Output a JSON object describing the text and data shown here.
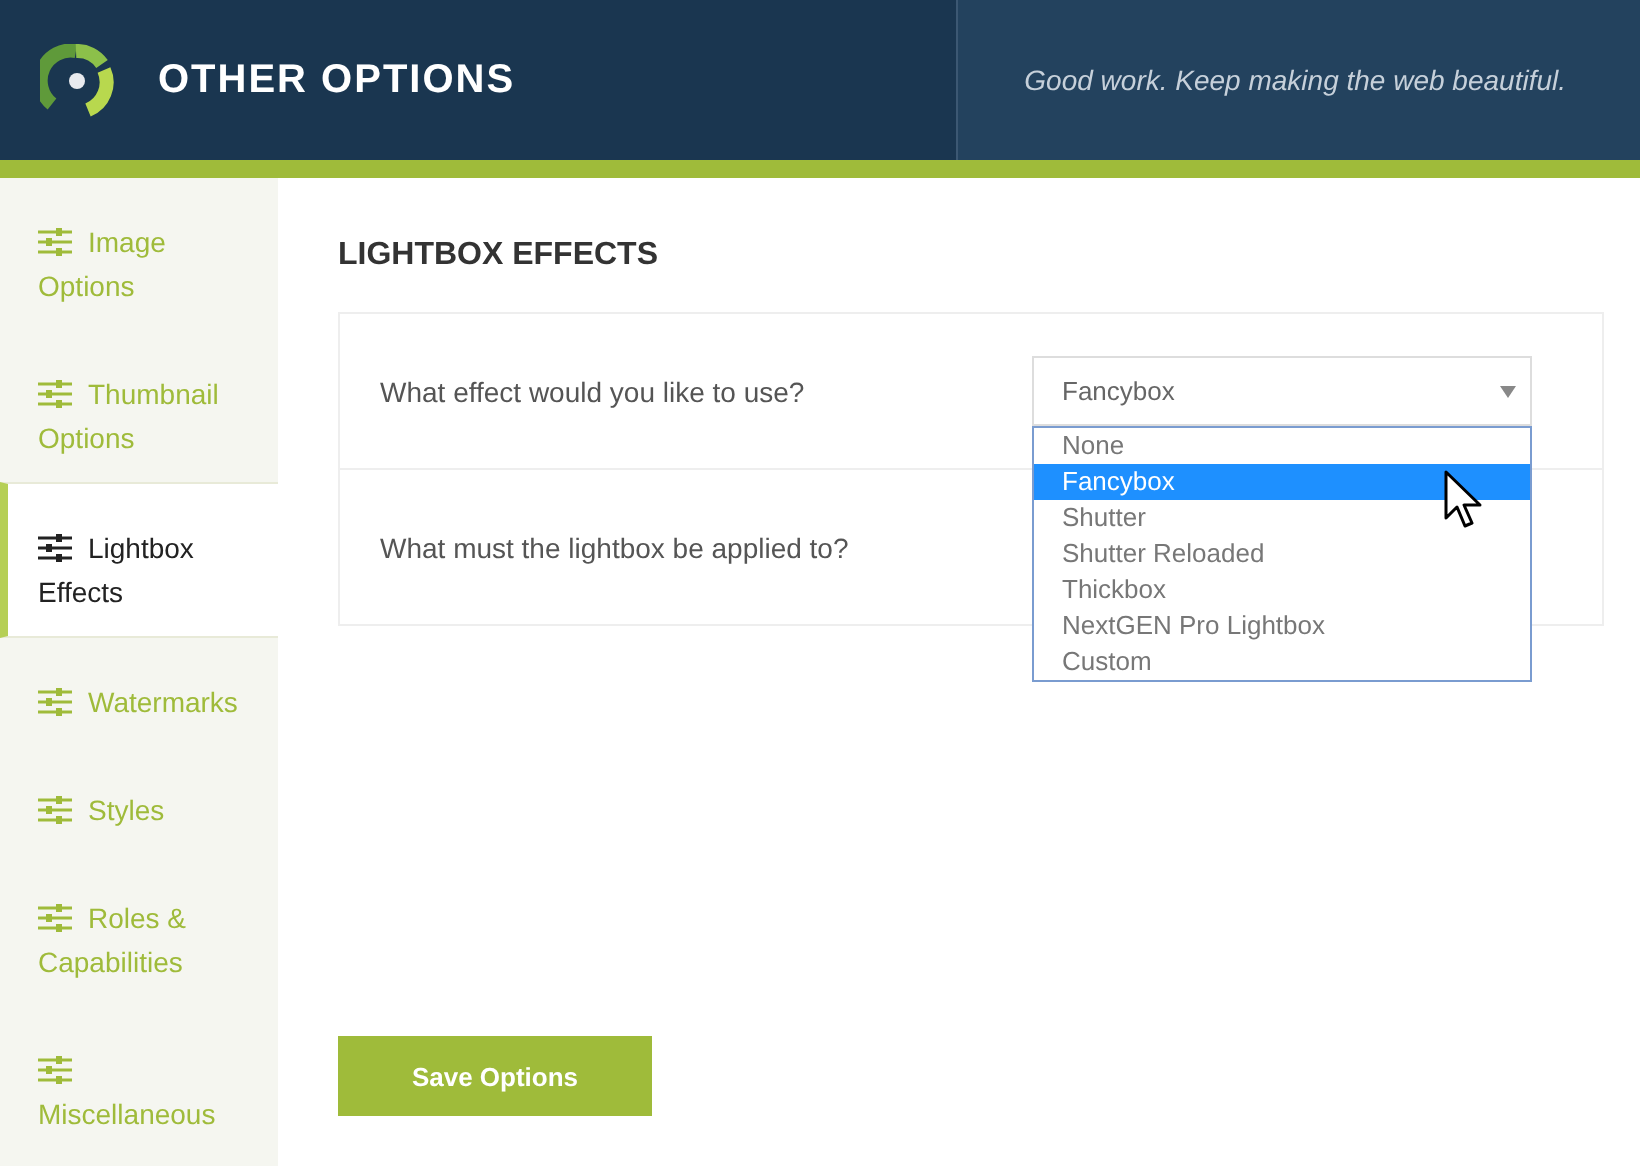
{
  "header": {
    "title": "OTHER OPTIONS",
    "tagline": "Good work. Keep making the web beautiful."
  },
  "sidebar": {
    "items": [
      {
        "label": "Image Options",
        "selected": false
      },
      {
        "label": "Thumbnail Options",
        "selected": false
      },
      {
        "label": "Lightbox Effects",
        "selected": true
      },
      {
        "label": "Watermarks",
        "selected": false
      },
      {
        "label": "Styles",
        "selected": false
      },
      {
        "label": "Roles & Capabilities",
        "selected": false
      },
      {
        "label": "Miscellaneous",
        "selected": false
      }
    ]
  },
  "section": {
    "title": "LIGHTBOX EFFECTS",
    "fields": [
      {
        "label": "What effect would you like to use?",
        "select": {
          "value": "Fancybox",
          "expanded": true,
          "options": [
            {
              "label": "None",
              "selected": false
            },
            {
              "label": "Fancybox",
              "selected": true
            },
            {
              "label": "Shutter",
              "selected": false
            },
            {
              "label": "Shutter Reloaded",
              "selected": false
            },
            {
              "label": "Thickbox",
              "selected": false
            },
            {
              "label": "NextGEN Pro Lightbox",
              "selected": false
            },
            {
              "label": "Custom",
              "selected": false
            }
          ]
        }
      },
      {
        "label": "What must the lightbox be applied to?"
      }
    ]
  },
  "save_button": "Save Options"
}
